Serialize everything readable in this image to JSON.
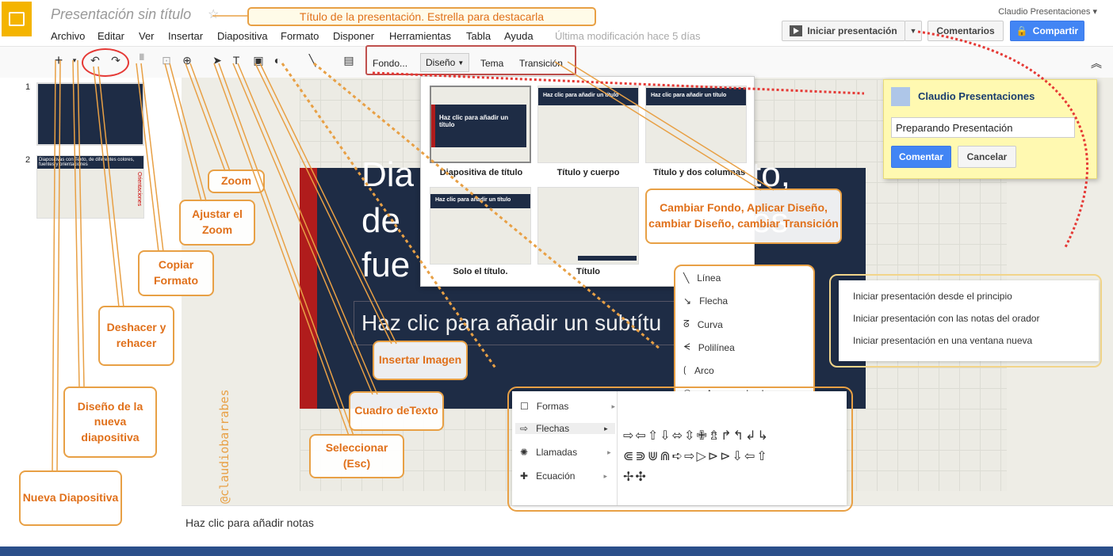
{
  "app": {
    "title": "Presentación sin título",
    "user": "Claudio Presentaciones ▾",
    "last_modified": "Última modificación hace 5 días",
    "present_label": "Iniciar presentación",
    "comments_label": "Comentarios",
    "share_label": "Compartir",
    "accent": "#4285f4",
    "logo_color": "#f4b400"
  },
  "menu": [
    "Archivo",
    "Editar",
    "Ver",
    "Insertar",
    "Diapositiva",
    "Formato",
    "Disponer",
    "Herramientas",
    "Tabla",
    "Ayuda"
  ],
  "toolbar": {
    "fondo": "Fondo...",
    "diseno": "Diseño",
    "tema": "Tema",
    "transicion": "Transición"
  },
  "slides": {
    "n1": "1",
    "n2": "2",
    "thumb2_title": "Diapositivas con Texto, de diferentes colores, fuentes y orientaciones",
    "thumb2_side": "Orientaciones"
  },
  "layouts": [
    {
      "label": "Diapositiva de título",
      "thumb": "Haz clic para añadir un título"
    },
    {
      "label": "Título y cuerpo",
      "thumb": "Haz clic para añadir un título"
    },
    {
      "label": "Título y dos columnas",
      "thumb": "Haz clic para añadir un título"
    },
    {
      "label": "Solo el título.",
      "thumb": "Haz clic para añadir un título"
    },
    {
      "label": "Título",
      "thumb": ""
    }
  ],
  "slide": {
    "title_frag1": "Dia",
    "title_frag2": "to,",
    "title_frag3": "de",
    "title_frag4": "es",
    "title_frag5": "fue",
    "subtitle": "Haz clic para añadir un subtítu"
  },
  "notes": "Haz clic para añadir notas",
  "comment": {
    "author": "Claudio Presentaciones",
    "text": "Preparando Presentación",
    "ok": "Comentar",
    "cancel": "Cancelar"
  },
  "present_menu": [
    "Iniciar presentación desde el principio",
    "Iniciar presentación con las notas del orador",
    "Iniciar presentación en una ventana nueva"
  ],
  "line_menu": [
    "Línea",
    "Flecha",
    "Curva",
    "Polilínea",
    "Arco",
    "A mano alzada"
  ],
  "shape_menu": [
    "Formas",
    "Flechas",
    "Llamadas",
    "Ecuación"
  ],
  "arrows_rows": [
    "⇨⇦⇧⇩⬄⇳✙⇯↱↰↲↳",
    "⋐⋑⋓⋒➪⇨▷⊳⊳⇩⇦⇧",
    "✢✣"
  ],
  "annotations": {
    "title_note": "Título de la presentación. Estrella para destacarla",
    "zoom": "Zoom",
    "ajustar": "Ajustar el Zoom",
    "copiar": "Copiar Formato",
    "deshacer": "Deshacer y rehacer",
    "diseno_nueva": "Diseño de la nueva diapositiva",
    "nueva": "Nueva Diapositiva",
    "insertar_img": "Insertar Imagen",
    "cuadro": "Cuadro deTexto",
    "seleccionar": "Seleccionar (Esc)",
    "cambiar": "Cambiar Fondo, Aplicar Diseño, cambiar Diseño, cambiar Transición",
    "watermark": "@claudiobarrabes"
  }
}
